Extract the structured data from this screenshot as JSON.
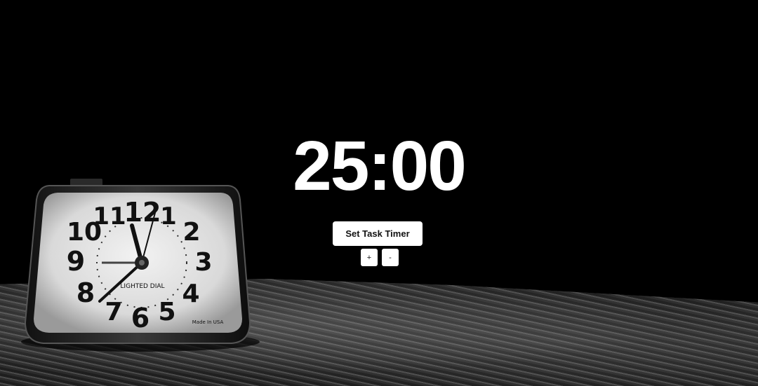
{
  "timer": {
    "display": "25:00"
  },
  "controls": {
    "set_task_timer_label": "Set Task Timer",
    "increment_label": "+",
    "decrement_label": "-"
  },
  "background": {
    "clock_numbers": [
      "12",
      "1",
      "2",
      "3",
      "4",
      "5",
      "6",
      "7",
      "8",
      "9",
      "10",
      "11"
    ],
    "clock_face_text": "LIGHTED DIAL",
    "clock_maker_text": "Made In USA"
  }
}
